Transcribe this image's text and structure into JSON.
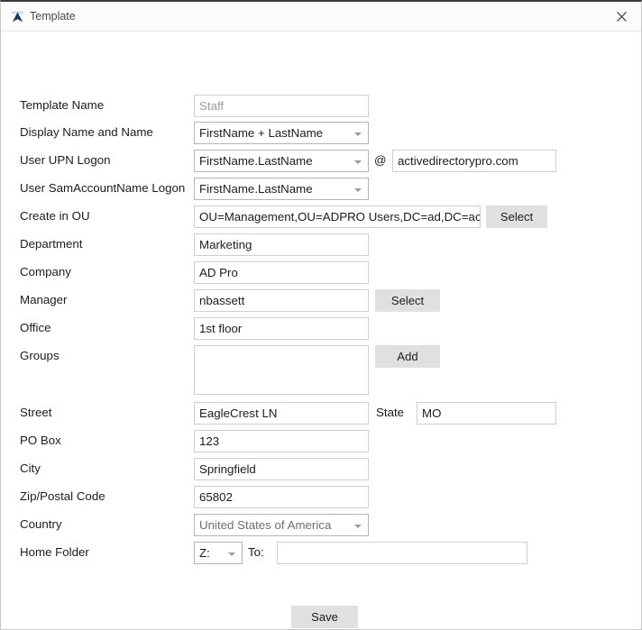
{
  "window": {
    "title": "Template",
    "app_icon": "app-logo-icon",
    "close_icon": "close-icon"
  },
  "form": {
    "rows": [
      {
        "label": "Template Name",
        "value": "Staff"
      },
      {
        "label": "Display Name and Name",
        "value": "FirstName + LastName"
      },
      {
        "label": "User UPN Logon",
        "value": "FirstName.LastName"
      },
      {
        "label": "User SamAccountName Logon",
        "value": "FirstName.LastName"
      },
      {
        "label": "Create in OU",
        "value": "OU=Management,OU=ADPRO Users,DC=ad,DC=activedirectorypro,DC=com"
      },
      {
        "label": "Department",
        "value": "Marketing"
      },
      {
        "label": "Company",
        "value": "AD Pro"
      },
      {
        "label": "Manager",
        "value": "nbassett"
      },
      {
        "label": "Office",
        "value": "1st floor"
      },
      {
        "label": "Groups",
        "value": ""
      },
      {
        "label": "Street",
        "value": "EagleCrest LN"
      },
      {
        "label": "PO Box",
        "value": "123"
      },
      {
        "label": "City",
        "value": "Springfield"
      },
      {
        "label": "Zip/Postal Code",
        "value": "65802"
      },
      {
        "label": "Country",
        "value": "United States of America"
      },
      {
        "label": "Home Folder",
        "value": ""
      }
    ],
    "upn": {
      "at_symbol": "@",
      "domain": "activedirectorypro.com"
    },
    "ou": {
      "select_label": "Select"
    },
    "manager": {
      "select_label": "Select"
    },
    "groups": {
      "add_label": "Add"
    },
    "state": {
      "label": "State",
      "value": "MO"
    },
    "home_folder": {
      "drive": "Z:",
      "to_label": "To:",
      "path": ""
    },
    "save_label": "Save"
  },
  "colors": {
    "window_border": "#c8c8cc",
    "titlebar_bg": "#fbfbfb",
    "button_bg": "#e0e0e0",
    "input_border": "#cfcfcf",
    "combo_border": "#b4b4b4",
    "text": "#1c1c1c",
    "placeholder_text": "#9b9b9b",
    "icon_blue": "#1f3864"
  }
}
